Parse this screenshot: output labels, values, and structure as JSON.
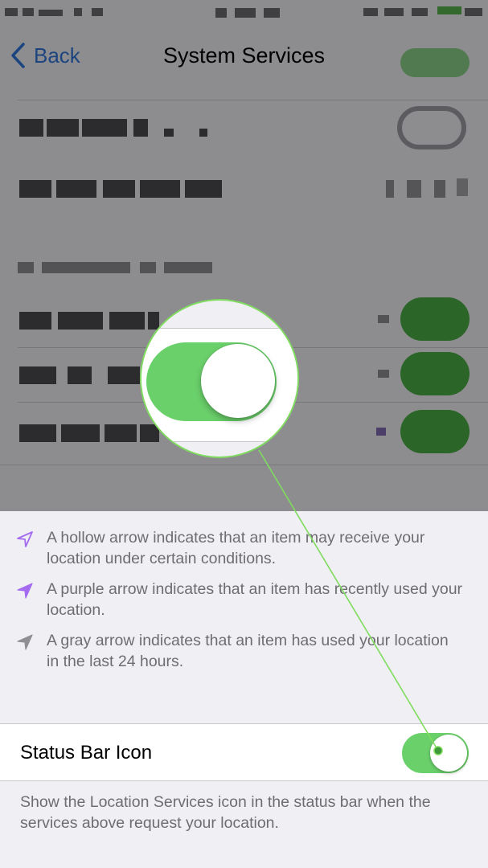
{
  "nav": {
    "back_label": "Back",
    "title": "System Services"
  },
  "legend": [
    {
      "icon": "hollow-location-arrow-icon",
      "text": "A hollow arrow indicates that an item may receive your location under certain conditions."
    },
    {
      "icon": "purple-location-arrow-icon",
      "text": "A purple arrow indicates that an item has recently used your location."
    },
    {
      "icon": "gray-location-arrow-icon",
      "text": "A gray arrow indicates that an item has used your location in the last 24 hours."
    }
  ],
  "status_bar_icon": {
    "label": "Status Bar Icon",
    "enabled": true,
    "footer": "Show the Location Services icon in the status bar when the services above request your location."
  },
  "colors": {
    "ios_blue": "#2f74d6",
    "toggle_green": "#6ad06a",
    "callout_green": "#7fdc5e",
    "purple_arrow": "#a46bf0",
    "gray_arrow": "#8e8e93"
  }
}
